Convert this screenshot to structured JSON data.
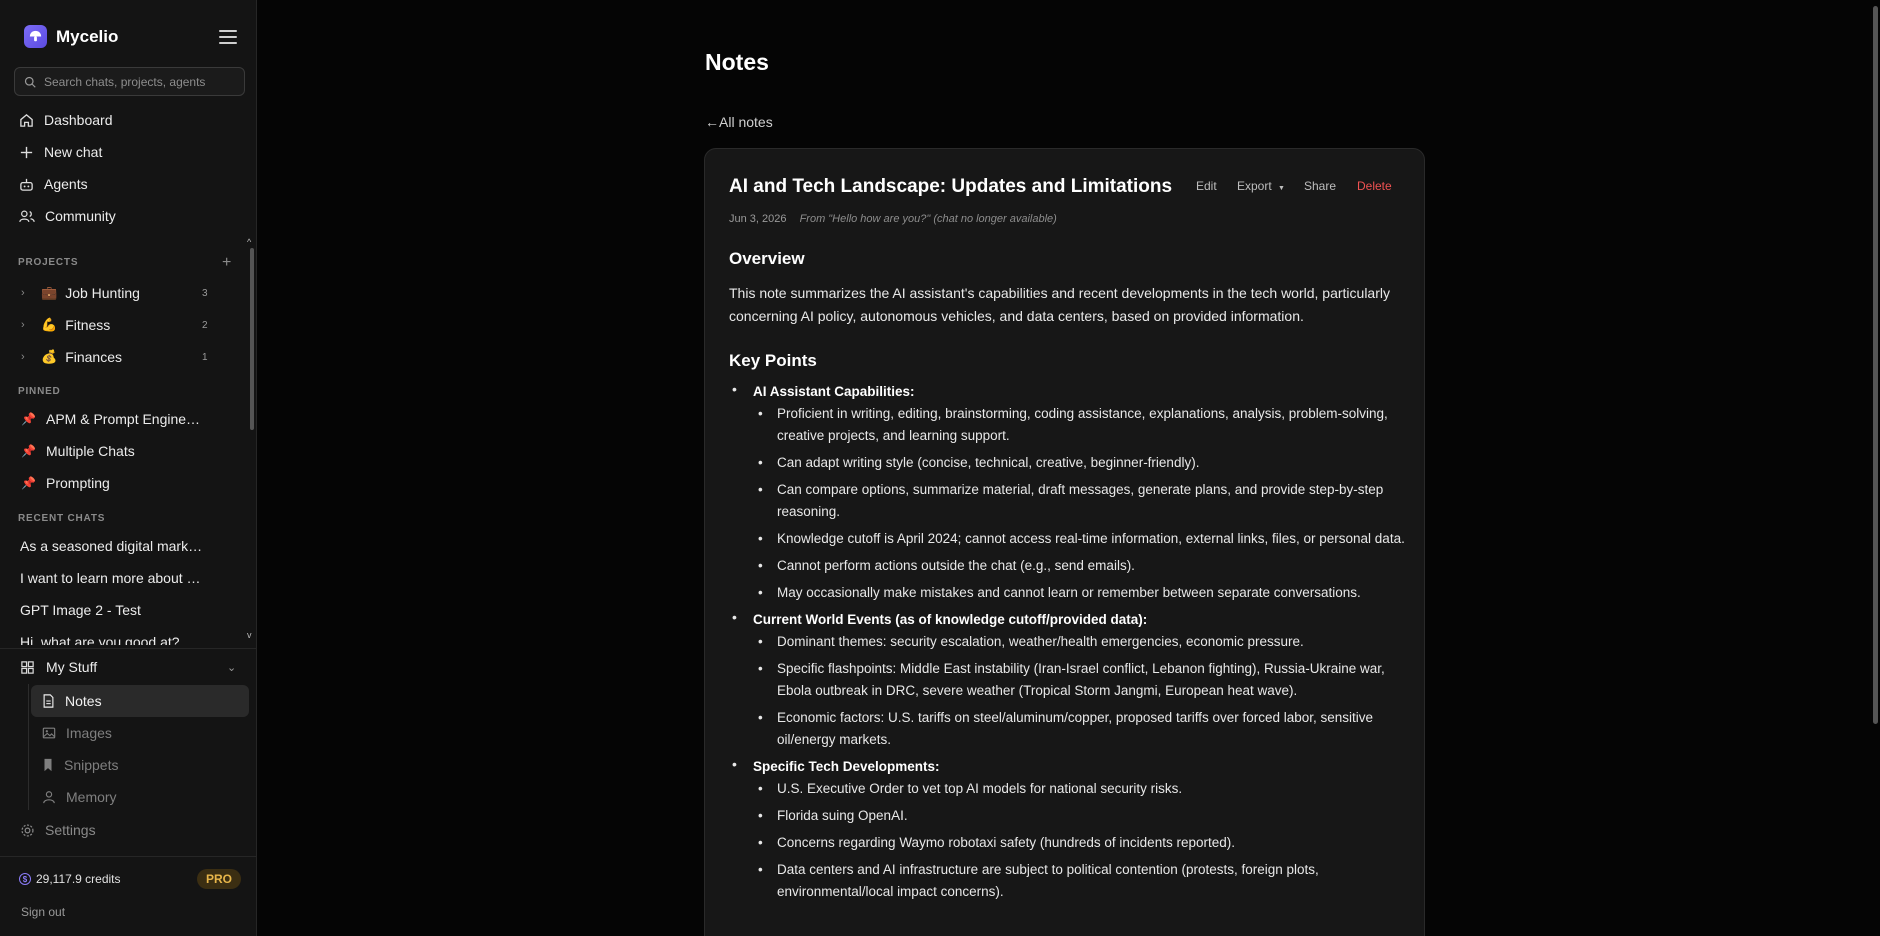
{
  "brand": {
    "name": "Mycelio"
  },
  "search": {
    "placeholder": "Search chats, projects, agents"
  },
  "nav": {
    "dashboard": "Dashboard",
    "new_chat": "New chat",
    "agents": "Agents",
    "community": "Community"
  },
  "projects": {
    "label": "PROJECTS",
    "items": [
      {
        "emoji": "💼",
        "label": "Job Hunting",
        "count": "3"
      },
      {
        "emoji": "💪",
        "label": "Fitness",
        "count": "2"
      },
      {
        "emoji": "💰",
        "label": "Finances",
        "count": "1"
      }
    ]
  },
  "pinned": {
    "label": "PINNED",
    "items": [
      "APM & Prompt Engine…",
      "Multiple Chats",
      "Prompting"
    ]
  },
  "recent": {
    "label": "RECENT CHATS",
    "items": [
      "As a seasoned digital mark…",
      "I want to learn more about …",
      "GPT Image 2 - Test",
      "Hi, what are you good at?"
    ]
  },
  "mystuff": {
    "label": "My Stuff",
    "items": [
      "Notes",
      "Images",
      "Snippets",
      "Memory"
    ]
  },
  "settings": "Settings",
  "credits": "29,117.9 credits",
  "plan": "PRO",
  "signout": "Sign out",
  "colors": {
    "accent": "#7c6cf6",
    "danger": "#f05252",
    "pro": "#e8b64a"
  },
  "main": {
    "title": "Notes",
    "back": "←All notes"
  },
  "note": {
    "title": "AI and Tech Landscape: Updates and Limitations",
    "actions": {
      "edit": "Edit",
      "export": "Export",
      "share": "Share",
      "delete": "Delete"
    },
    "date": "Jun 3, 2026",
    "source": "From \"Hello how are you?\" (chat no longer available)",
    "overview_heading": "Overview",
    "overview_text": "This note summarizes the AI assistant's capabilities and recent developments in the tech world, particularly concerning AI policy, autonomous vehicles, and data centers, based on provided information.",
    "key_points_heading": "Key Points",
    "sections": [
      {
        "heading": "AI Assistant Capabilities:",
        "points": [
          "Proficient in writing, editing, brainstorming, coding assistance, explanations, analysis, problem-solving, creative projects, and learning support.",
          "Can adapt writing style (concise, technical, creative, beginner-friendly).",
          "Can compare options, summarize material, draft messages, generate plans, and provide step-by-step reasoning.",
          "Knowledge cutoff is April 2024; cannot access real-time information, external links, files, or personal data.",
          "Cannot perform actions outside the chat (e.g., send emails).",
          "May occasionally make mistakes and cannot learn or remember between separate conversations."
        ]
      },
      {
        "heading": "Current World Events (as of knowledge cutoff/provided data):",
        "points": [
          "Dominant themes: security escalation, weather/health emergencies, economic pressure.",
          "Specific flashpoints: Middle East instability (Iran-Israel conflict, Lebanon fighting), Russia-Ukraine war, Ebola outbreak in DRC, severe weather (Tropical Storm Jangmi, European heat wave).",
          "Economic factors: U.S. tariffs on steel/aluminum/copper, proposed tariffs over forced labor, sensitive oil/energy markets."
        ]
      },
      {
        "heading": "Specific Tech Developments:",
        "points": [
          "U.S. Executive Order to vet top AI models for national security risks.",
          "Florida suing OpenAI.",
          "Concerns regarding Waymo robotaxi safety (hundreds of incidents reported).",
          "Data centers and AI infrastructure are subject to political contention (protests, foreign plots, environmental/local impact concerns)."
        ]
      }
    ]
  }
}
